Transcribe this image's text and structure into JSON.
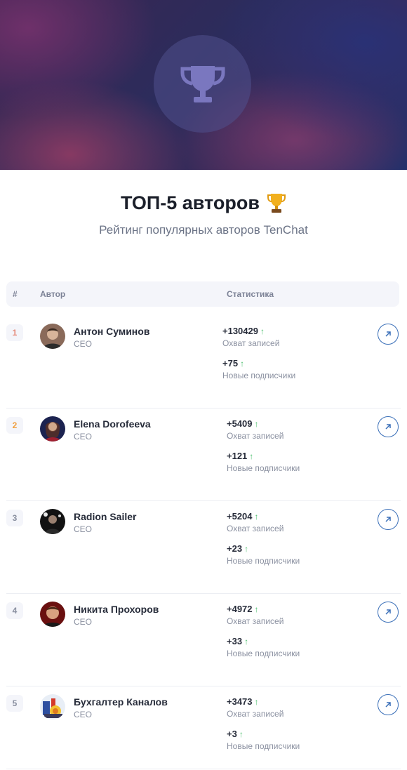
{
  "header": {
    "title": "ТОП-5 авторов",
    "trophy_emoji": "🏆",
    "subtitle": "Рейтинг популярных авторов TenChat"
  },
  "table": {
    "columns": [
      "#",
      "Автор",
      "Статистика"
    ],
    "rows": [
      {
        "rank": "1",
        "rank_color": "#e58a7a",
        "name": "Антон Суминов",
        "role": "CEO",
        "reach": "+130429",
        "reach_label": "Охват записей",
        "subs": "+75",
        "subs_label": "Новые подписчики"
      },
      {
        "rank": "2",
        "rank_color": "#f0a040",
        "name": "Elena Dorofeeva",
        "role": "CEO",
        "reach": "+5409",
        "reach_label": "Охват записей",
        "subs": "+121",
        "subs_label": "Новые подписчики"
      },
      {
        "rank": "3",
        "rank_color": "#8a90a0",
        "name": "Radion Sailer",
        "role": "CEO",
        "reach": "+5204",
        "reach_label": "Охват записей",
        "subs": "+23",
        "subs_label": "Новые подписчики"
      },
      {
        "rank": "4",
        "rank_color": "#8a90a0",
        "name": "Никита Прохоров",
        "role": "CEO",
        "reach": "+4972",
        "reach_label": "Охват записей",
        "subs": "+33",
        "subs_label": "Новые подписчики"
      },
      {
        "rank": "5",
        "rank_color": "#8a90a0",
        "name": "Бухгалтер Каналов",
        "role": "CEO",
        "reach": "+3473",
        "reach_label": "Охват записей",
        "subs": "+3",
        "subs_label": "Новые подписчики"
      }
    ]
  },
  "icons": {
    "hero": "trophy-icon",
    "trend": "arrow-up-icon",
    "open": "arrow-up-right-icon"
  },
  "colors": {
    "accent": "#3a6fb8",
    "trend_up": "#4cbf6e"
  }
}
